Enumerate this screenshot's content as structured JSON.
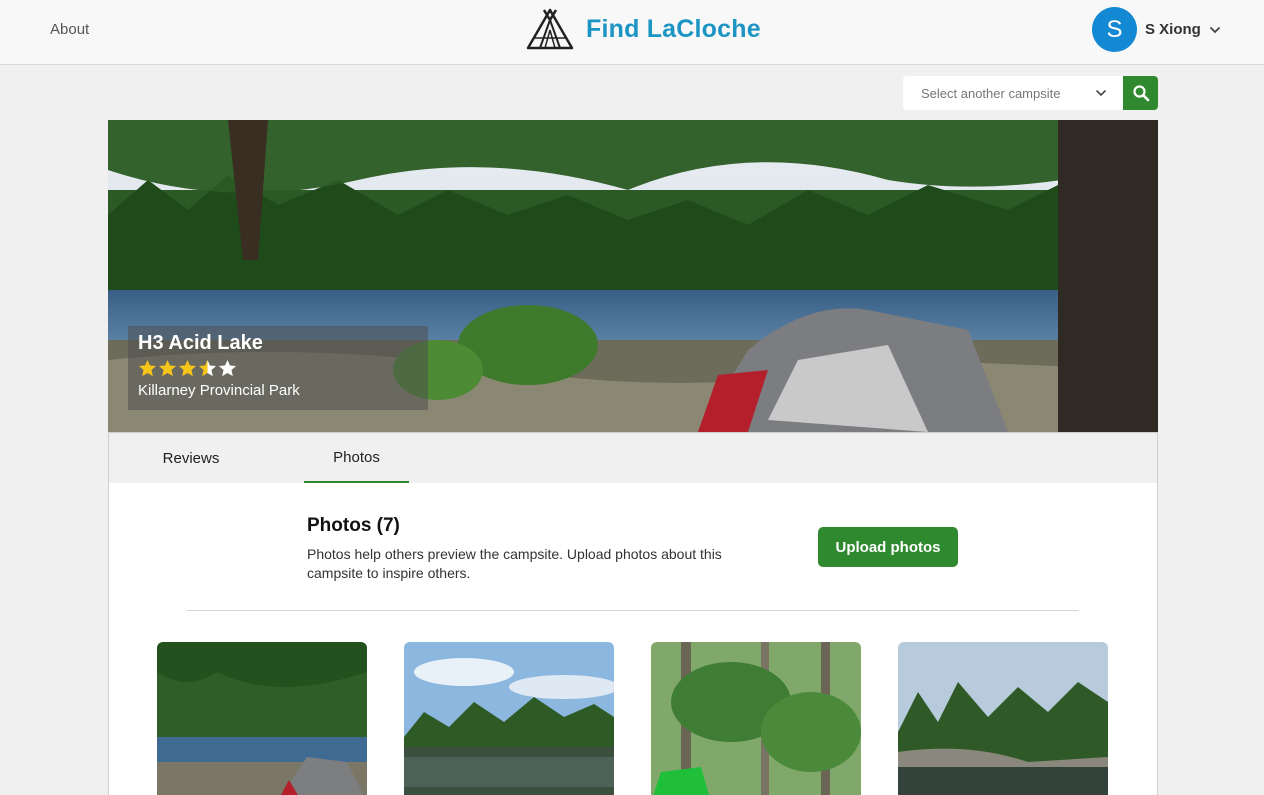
{
  "header": {
    "about_label": "About",
    "brand_name": "Find LaCloche",
    "user": {
      "initial": "S",
      "name": "S Xiong"
    }
  },
  "campsite_search": {
    "placeholder": "Select another campsite"
  },
  "campsite": {
    "name": "H3 Acid Lake",
    "rating": 3.5,
    "rating_max": 5,
    "park": "Killarney Provincial Park"
  },
  "tabs": [
    {
      "label": "Reviews",
      "active": false
    },
    {
      "label": "Photos",
      "active": true
    }
  ],
  "photos_section": {
    "title": "Photos (7)",
    "description": "Photos help others preview the campsite. Upload photos about this campsite to inspire others.",
    "upload_label": "Upload photos"
  },
  "colors": {
    "brand": "#1c94c4",
    "accent_green": "#2f8a2f",
    "avatar": "#1389d3",
    "star": "#f5c518"
  },
  "icons": [
    "tent-logo-icon",
    "chevron-down-icon",
    "search-icon",
    "star-icon"
  ]
}
